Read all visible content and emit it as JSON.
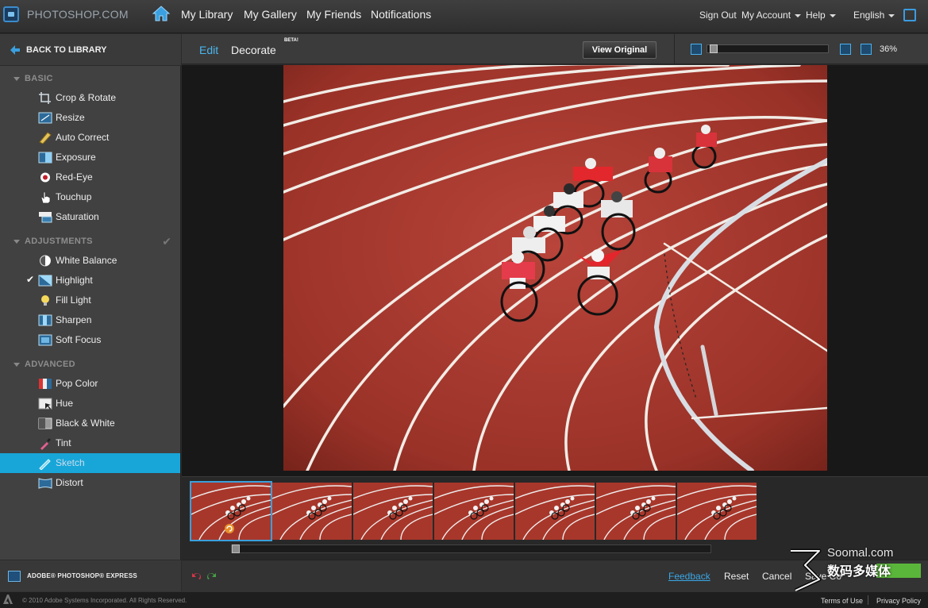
{
  "topbar": {
    "brand": "PHOTOSHOP.COM",
    "nav": [
      "My Library",
      "My Gallery",
      "My Friends",
      "Notifications"
    ],
    "sign_out": "Sign Out",
    "my_account": "My Account",
    "help": "Help",
    "language": "English"
  },
  "sidebar": {
    "back_label": "BACK TO LIBRARY",
    "sections": {
      "basic": "BASIC",
      "adjustments": "ADJUSTMENTS",
      "advanced": "ADVANCED"
    },
    "basic_tools": [
      "Crop & Rotate",
      "Resize",
      "Auto Correct",
      "Exposure",
      "Red-Eye",
      "Touchup",
      "Saturation"
    ],
    "adjustment_tools": [
      "White Balance",
      "Highlight",
      "Fill Light",
      "Sharpen",
      "Soft Focus"
    ],
    "advanced_tools": [
      "Pop Color",
      "Hue",
      "Black & White",
      "Tint",
      "Sketch",
      "Distort"
    ],
    "checked_tool": "Highlight",
    "active_tool": "Sketch",
    "footer_label": "ADOBE® PHOTOSHOP® EXPRESS"
  },
  "editor": {
    "tab_edit": "Edit",
    "tab_decorate": "Decorate",
    "beta_badge": "BETA!",
    "view_original": "View Original",
    "zoom_percent": "36%",
    "zoom_level": 0.02
  },
  "filmstrip": {
    "thumbnail_count": 7,
    "selected_index": 0
  },
  "actions": {
    "feedback": "Feedback",
    "reset": "Reset",
    "cancel": "Cancel",
    "save_partial": "Save Co"
  },
  "watermark": {
    "site": "Soomal.com",
    "chinese": "数码多媒体"
  },
  "footer": {
    "copyright": "© 2010 Adobe Systems Incorporated. All Rights Reserved.",
    "terms": "Terms of Use",
    "privacy": "Privacy Policy"
  },
  "colors": {
    "accent": "#18a6d8",
    "link": "#3aa8e8",
    "track_red": "#a8372b"
  }
}
